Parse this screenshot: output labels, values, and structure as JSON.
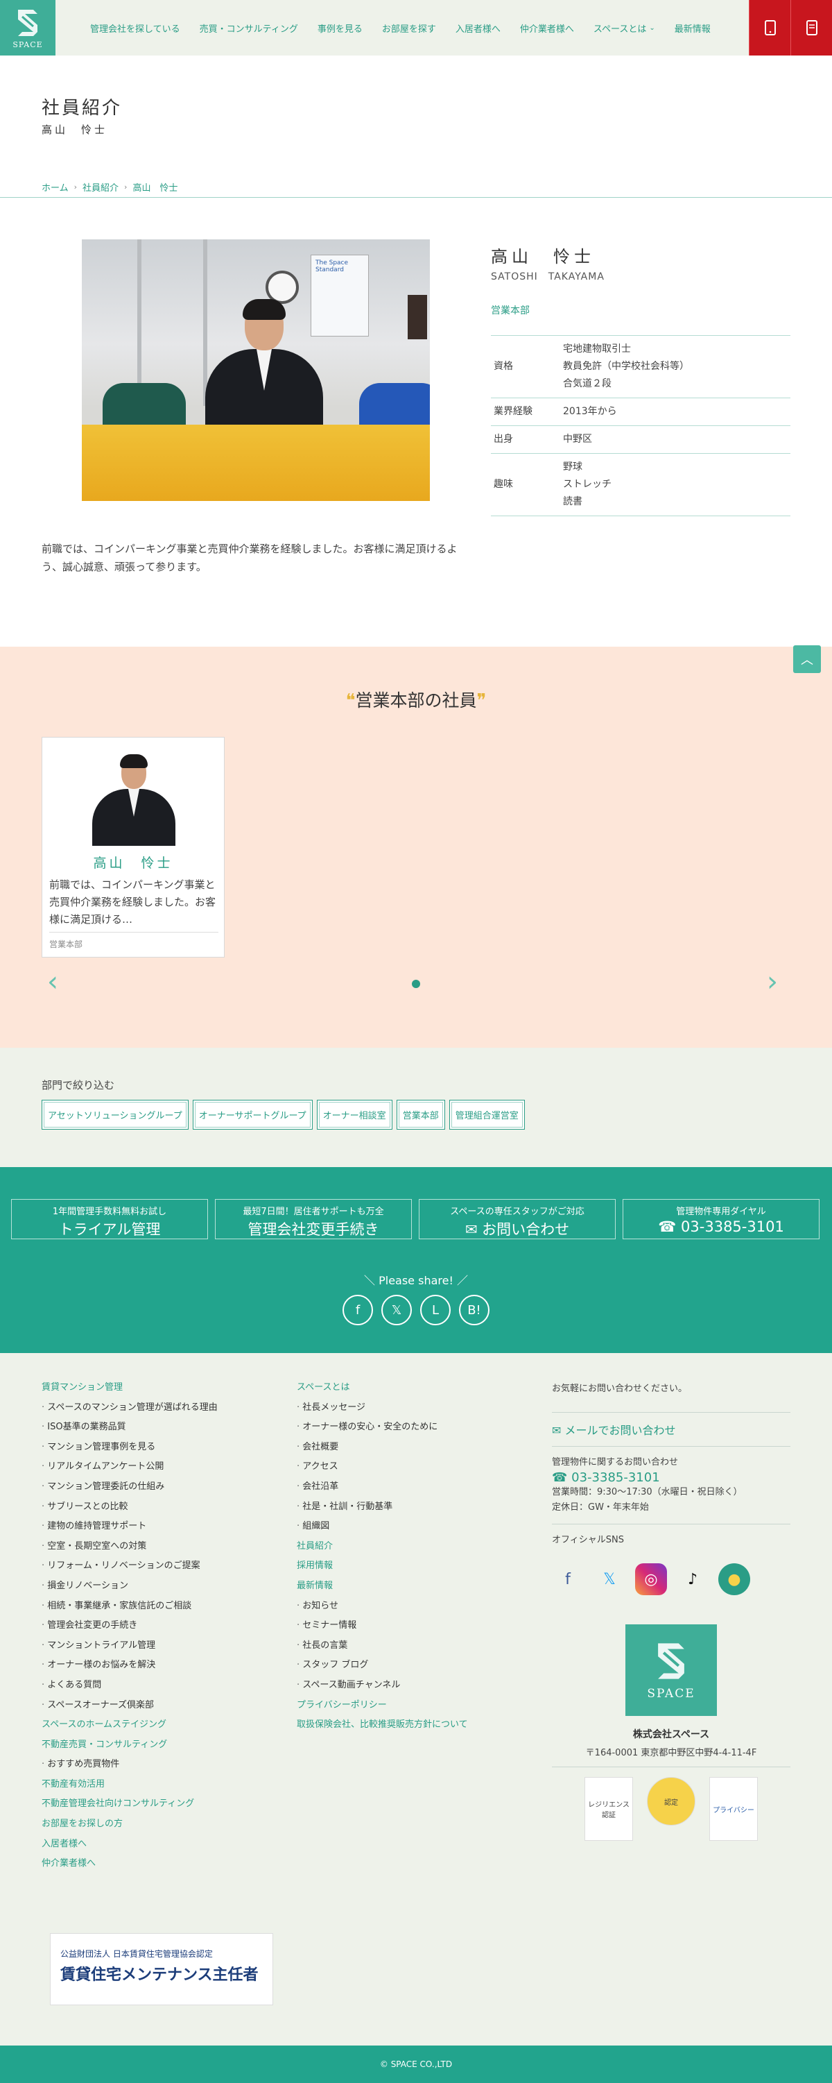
{
  "header": {
    "logo_text": "SPACE",
    "nav": [
      {
        "label": "管理会社を探している"
      },
      {
        "label": "売買・コンサルティング"
      },
      {
        "label": "事例を見る"
      },
      {
        "label": "お部屋を探す"
      },
      {
        "label": "入居者様へ"
      },
      {
        "label": "仲介業者様へ"
      },
      {
        "label": "スペースとは"
      },
      {
        "label": "最新情報"
      }
    ],
    "buttons": [
      {
        "icon": "phone-icon"
      },
      {
        "icon": "mail-icon"
      }
    ]
  },
  "page": {
    "title": "社員紹介",
    "subtitle": "高山　怜士"
  },
  "breadcrumb": [
    "ホーム",
    "社員紹介",
    "高山　怜士"
  ],
  "profile": {
    "name": "高山　怜士",
    "name_en": "SATOSHI　TAKAYAMA",
    "department": "営業本部",
    "photo_poster": "The Space Standard",
    "rows": [
      {
        "key": "資格",
        "values": [
          "宅地建物取引士",
          "教員免許（中学校社会科等）",
          "合気道２段"
        ]
      },
      {
        "key": "業界経験",
        "values": [
          "2013年から"
        ]
      },
      {
        "key": "出身",
        "values": [
          "中野区"
        ]
      },
      {
        "key": "趣味",
        "values": [
          "野球",
          "ストレッチ",
          "読書"
        ]
      }
    ],
    "bio": "前職では、コインパーキング事業と売買仲介業務を経験しました。お客様に満足頂けるよう、誠心誠意、頑張って参ります。"
  },
  "staff": {
    "title": "営業本部の社員",
    "cards": [
      {
        "name": "高山　怜士",
        "text": "前職では、コインパーキング事業と売買仲介業務を経験しました。お客様に満足頂ける…",
        "dept": "営業本部"
      }
    ]
  },
  "filter": {
    "label": "部門で絞り込む",
    "buttons": [
      "アセットソリューショングループ",
      "オーナーサポートグループ",
      "オーナー相談室",
      "営業本部",
      "管理組合運営室"
    ]
  },
  "cta": [
    {
      "sub": "1年間管理手数料無料お試し",
      "main": "トライアル管理"
    },
    {
      "sub": "最短7日間！居住者サポートも万全",
      "main": "管理会社変更手続き"
    },
    {
      "sub": "スペースの専任スタッフがご対応",
      "main": "お問い合わせ"
    },
    {
      "sub": "管理物件専用ダイヤル",
      "main": "03-3385-3101"
    }
  ],
  "share": {
    "label": "＼ Please share! ／"
  },
  "footer": {
    "col1": [
      {
        "t": "h",
        "label": "賃貸マンション管理"
      },
      {
        "t": "i",
        "label": "スペースのマンション管理が選ばれる理由"
      },
      {
        "t": "i",
        "label": "ISO基準の業務品質"
      },
      {
        "t": "i",
        "label": "マンション管理事例を見る"
      },
      {
        "t": "i",
        "label": "リアルタイムアンケート公開"
      },
      {
        "t": "i",
        "label": "マンション管理委託の仕組み"
      },
      {
        "t": "i",
        "label": "サブリースとの比較"
      },
      {
        "t": "i",
        "label": "建物の維持管理サポート"
      },
      {
        "t": "i",
        "label": "空室・長期空室への対策"
      },
      {
        "t": "i",
        "label": "リフォーム・リノベーションのご提案"
      },
      {
        "t": "i",
        "label": "損金リノベーション"
      },
      {
        "t": "i",
        "label": "相続・事業継承・家族信託のご相談"
      },
      {
        "t": "i",
        "label": "管理会社変更の手続き"
      },
      {
        "t": "i",
        "label": "マンショントライアル管理"
      },
      {
        "t": "i",
        "label": "オーナー様のお悩みを解決"
      },
      {
        "t": "i",
        "label": "よくある質問"
      },
      {
        "t": "i",
        "label": "スペースオーナーズ倶楽部"
      },
      {
        "t": "h",
        "label": "スペースのホームステイジング"
      },
      {
        "t": "h",
        "label": "不動産売買・コンサルティング"
      },
      {
        "t": "i",
        "label": "おすすめ売買物件"
      },
      {
        "t": "h",
        "label": "不動産有効活用"
      },
      {
        "t": "h",
        "label": "不動産管理会社向けコンサルティング"
      },
      {
        "t": "h",
        "label": "お部屋をお探しの方"
      },
      {
        "t": "h",
        "label": "入居者様へ"
      },
      {
        "t": "h",
        "label": "仲介業者様へ"
      }
    ],
    "col2": [
      {
        "t": "h",
        "label": "スペースとは"
      },
      {
        "t": "i",
        "label": "社長メッセージ"
      },
      {
        "t": "i",
        "label": "オーナー様の安心・安全のために"
      },
      {
        "t": "i",
        "label": "会社概要"
      },
      {
        "t": "i",
        "label": "アクセス"
      },
      {
        "t": "i",
        "label": "会社沿革"
      },
      {
        "t": "i",
        "label": "社是・社訓・行動基準"
      },
      {
        "t": "i",
        "label": "組織図"
      },
      {
        "t": "h",
        "label": "社員紹介"
      },
      {
        "t": "h",
        "label": "採用情報"
      },
      {
        "t": "h",
        "label": "最新情報"
      },
      {
        "t": "i",
        "label": "お知らせ"
      },
      {
        "t": "i",
        "label": "セミナー情報"
      },
      {
        "t": "i",
        "label": "社長の言葉"
      },
      {
        "t": "i",
        "label": "スタッフ ブログ"
      },
      {
        "t": "i",
        "label": "スペース動画チャンネル"
      },
      {
        "t": "h",
        "label": "プライバシーポリシー"
      },
      {
        "t": "h",
        "label": "取扱保険会社、比較推奨販売方針について"
      }
    ],
    "contact_lead": "お気軽にお問い合わせください。",
    "mail_label": "メールでお問い合わせ",
    "tel_lead": "管理物件に関するお問い合わせ",
    "tel": "03-3385-3101",
    "hours": "営業時間：9:30〜17:30（水曜日・祝日除く）",
    "holiday": "定休日：GW・年末年始",
    "sns_label": "オフィシャルSNS",
    "logo_text": "SPACE",
    "company": "株式会社スペース",
    "address": "〒164-0001 東京都中野区中野4-4-11-4F",
    "badges": [
      "レジリエンス認証",
      "認定",
      "プライバシー"
    ],
    "maint_small": "公益財団法人 日本賃貸住宅管理協会認定",
    "maint_big": "賃貸住宅メンテナンス主任者",
    "copyright": "© SPACE CO.,LTD"
  },
  "colors": {
    "accent": "#2a9d86",
    "header_button": "#c8161e",
    "staff_bg": "#fde6d9",
    "cta_bg": "#22a48d"
  }
}
